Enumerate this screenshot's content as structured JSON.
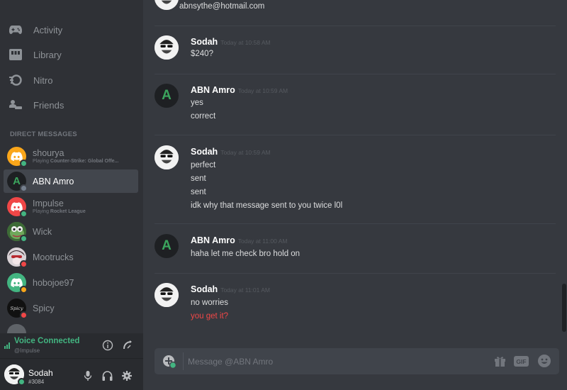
{
  "nav": {
    "activity": "Activity",
    "library": "Library",
    "nitro": "Nitro",
    "friends": "Friends"
  },
  "dm_header": "DIRECT MESSAGES",
  "dms": [
    {
      "name": "shourya",
      "activity_prefix": "Playing",
      "activity": "Counter-Strike: Global Offe...",
      "status": "online",
      "avatar_color": "#faa61a"
    },
    {
      "name": "ABN Amro",
      "activity_prefix": "",
      "activity": "",
      "status": "offline",
      "avatar_color": "#1e2023",
      "avatar_letter": "A"
    },
    {
      "name": "Impulse",
      "activity_prefix": "Playing",
      "activity": "Rocket League",
      "status": "online",
      "avatar_color": "#f04747"
    },
    {
      "name": "Wick",
      "activity_prefix": "",
      "activity": "",
      "status": "online",
      "avatar_color": "#5a8f4e"
    },
    {
      "name": "Mootrucks",
      "activity_prefix": "",
      "activity": "",
      "status": "dnd",
      "avatar_color": "#7a6a70"
    },
    {
      "name": "hobojoe97",
      "activity_prefix": "",
      "activity": "",
      "status": "idle",
      "avatar_color": "#43b581"
    },
    {
      "name": "Spicy",
      "activity_prefix": "",
      "activity": "",
      "status": "dnd",
      "avatar_color": "#111111",
      "avatar_text": "Spicy"
    }
  ],
  "voice": {
    "title": "Voice Connected",
    "channel": "@Impulse"
  },
  "user": {
    "name": "Sodah",
    "tag": "#3084"
  },
  "chat": {
    "top_partial": "abnsythe@hotmail.com",
    "messages": [
      {
        "author": "Sodah",
        "timestamp": "Today at 10:58 AM",
        "lines": [
          "$240?"
        ]
      },
      {
        "author": "ABN Amro",
        "timestamp": "Today at 10:59 AM",
        "lines": [
          "yes",
          "correct"
        ]
      },
      {
        "author": "Sodah",
        "timestamp": "Today at 10:59 AM",
        "lines": [
          "perfect",
          "sent",
          "sent",
          "idk why that message sent to you twice l0l"
        ]
      },
      {
        "author": "ABN Amro",
        "timestamp": "Today at 11:00 AM",
        "lines": [
          "haha let me check bro hold on"
        ]
      },
      {
        "author": "Sodah",
        "timestamp": "Today at 11:01 AM",
        "lines": [
          "no worries",
          "you get it?"
        ],
        "pending_line": 1
      }
    ]
  },
  "composer": {
    "placeholder": "Message @ABN Amro"
  },
  "colors": {
    "accent_green": "#43b581",
    "error_red": "#f04747",
    "abn_green": "#3ba55d"
  }
}
